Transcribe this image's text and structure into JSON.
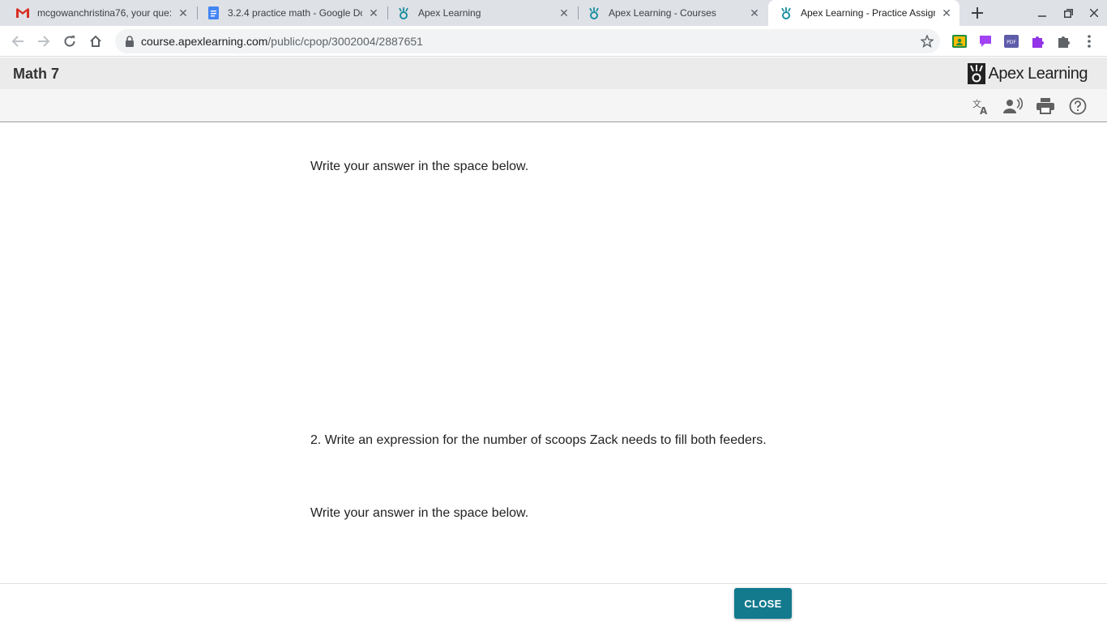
{
  "browser": {
    "tabs": [
      {
        "title": "mcgowanchristina76, your que:",
        "icon": "gmail-icon"
      },
      {
        "title": "3.2.4 practice math - Google Do",
        "icon": "google-docs-icon"
      },
      {
        "title": "Apex Learning",
        "icon": "apex-icon"
      },
      {
        "title": "Apex Learning - Courses",
        "icon": "apex-icon"
      },
      {
        "title": "Apex Learning - Practice Assign",
        "icon": "apex-icon"
      }
    ],
    "active_tab": 4,
    "url_host": "course.apexlearning.com",
    "url_path": "/public/cpop/3002004/2887651"
  },
  "app": {
    "course_title": "Math 7",
    "brand_name": "Apex Learning",
    "accent_color": "#137a8e"
  },
  "content": {
    "instruction_1": "Write your answer in the space below.",
    "question_2": "2. Write an expression for the number of scoops Zack needs to fill both feeders.",
    "instruction_2": "Write your answer in the space below."
  },
  "footer": {
    "close_label": "CLOSE"
  }
}
